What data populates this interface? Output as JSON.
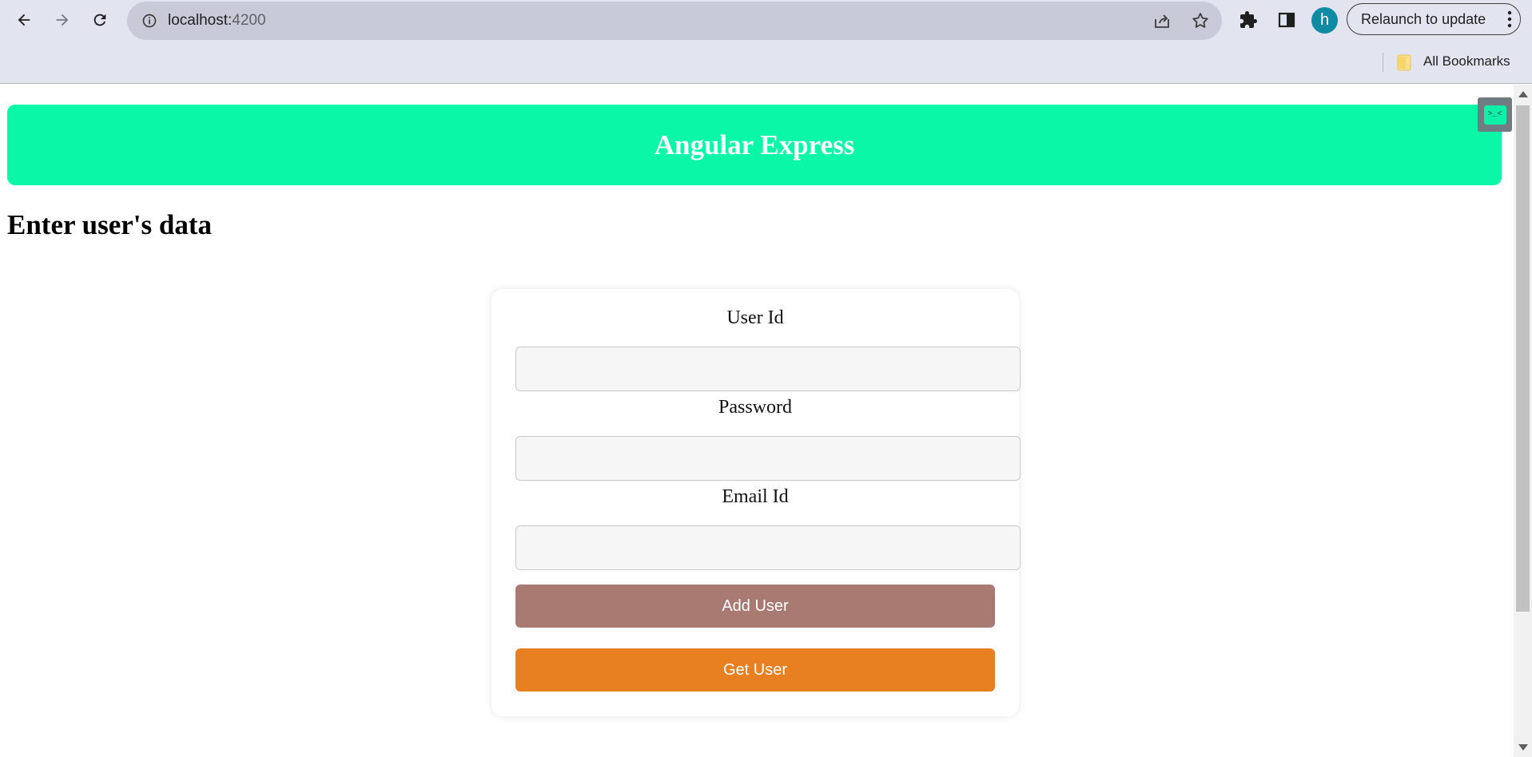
{
  "browser": {
    "url_host": "localhost:",
    "url_port": "4200",
    "avatar_letter": "h",
    "relaunch_label": "Relaunch to update",
    "bookmarks_label": "All Bookmarks"
  },
  "header": {
    "title": "Angular Express",
    "bg_color": "#09f7a7"
  },
  "page": {
    "title": "Enter user's data"
  },
  "form": {
    "user_id_label": "User Id",
    "user_id_value": "",
    "password_label": "Password",
    "password_value": "",
    "email_label": "Email Id",
    "email_value": "",
    "add_button_label": "Add User",
    "get_button_label": "Get User",
    "add_button_color": "#a97a72",
    "get_button_color": "#e87f21"
  },
  "extension_widget": {
    "glyph": ">_<"
  }
}
